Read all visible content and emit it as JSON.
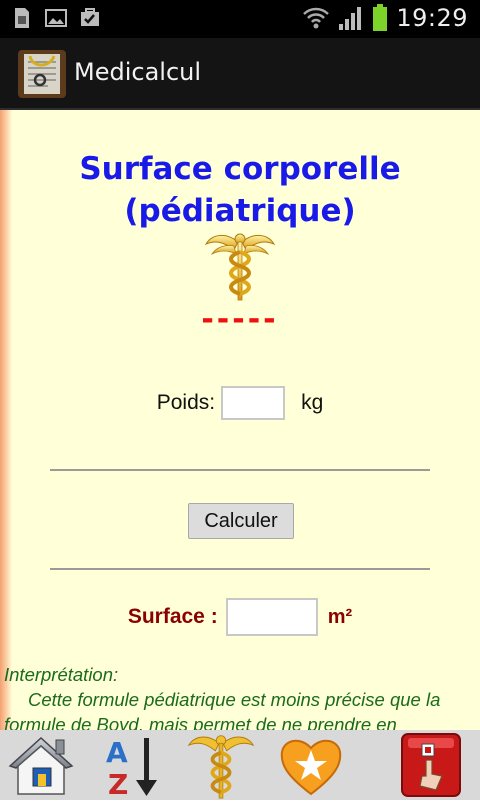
{
  "status_bar": {
    "time": "19:29",
    "icons": [
      "sim-card-icon",
      "image-icon",
      "checkbox-icon",
      "wifi-icon",
      "signal-icon",
      "battery-icon"
    ]
  },
  "app": {
    "title": "Medicalcul"
  },
  "main": {
    "title_line1": "Surface corporelle",
    "title_line2": "(pédiatrique)",
    "result_placeholder": "-----",
    "poids_label": "Poids:",
    "poids_value": "",
    "poids_unit": "kg",
    "calculate_label": "Calculer",
    "surface_label": "Surface :",
    "surface_value": "",
    "surface_unit": "m²",
    "interpretation_heading": "Interprétation:",
    "interpretation_text": "Cette formule pédiatrique est moins précise que la formule de Boyd, mais permet de ne prendre en"
  },
  "bottom_nav": [
    {
      "name": "home-icon"
    },
    {
      "name": "alphabetical-sort-icon"
    },
    {
      "name": "caduceus-icon"
    },
    {
      "name": "favorites-icon"
    },
    {
      "name": "exit-icon"
    }
  ],
  "colors": {
    "title": "#1a1ae8",
    "dashes": "#ee1111",
    "surface_label": "#8b0000",
    "interpretation": "#1a6b1a",
    "background": "#ffffd8"
  }
}
